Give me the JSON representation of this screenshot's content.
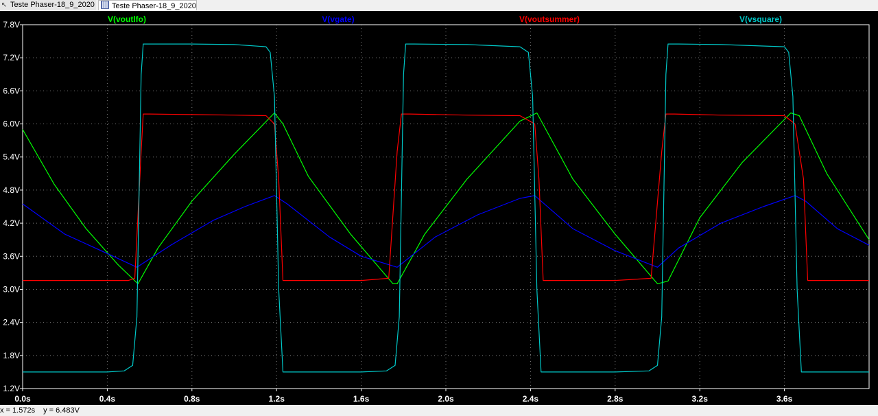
{
  "tabs": [
    {
      "label": "Teste Phaser-18_9_2020",
      "icon": "probe-icon"
    },
    {
      "label": "Teste Phaser-18_9_2020",
      "icon": "waveform-icon"
    }
  ],
  "status": {
    "x": "x = 1.572s",
    "y": "y = 6.483V"
  },
  "chart_data": {
    "type": "line",
    "title": "",
    "xlabel": "",
    "ylabel": "",
    "xlim": [
      0,
      4.0
    ],
    "ylim": [
      1.2,
      7.8
    ],
    "x_ticks": [
      0.0,
      0.4,
      0.8,
      1.2,
      1.6,
      2.0,
      2.4,
      2.8,
      3.2,
      3.6
    ],
    "x_tick_labels": [
      "0.0s",
      "0.4s",
      "0.8s",
      "1.2s",
      "1.6s",
      "2.0s",
      "2.4s",
      "2.8s",
      "3.2s",
      "3.6s"
    ],
    "y_ticks": [
      1.2,
      1.8,
      2.4,
      3.0,
      3.6,
      4.2,
      4.8,
      5.4,
      6.0,
      6.6,
      7.2,
      7.8
    ],
    "y_tick_labels": [
      "1.2V",
      "1.8V",
      "2.4V",
      "3.0V",
      "3.6V",
      "4.2V",
      "4.8V",
      "5.4V",
      "6.0V",
      "6.6V",
      "7.2V",
      "7.8V"
    ],
    "grid": true,
    "legend_position": "top",
    "background": "#000000",
    "series": [
      {
        "name": "V(voutlfo)",
        "color": "#00ff00",
        "x": [
          0.0,
          0.15,
          0.3,
          0.45,
          0.545,
          0.64,
          0.8,
          1.0,
          1.19,
          1.23,
          1.35,
          1.55,
          1.75,
          1.77,
          1.9,
          2.1,
          2.35,
          2.43,
          2.6,
          2.8,
          3.0,
          3.05,
          3.2,
          3.4,
          3.63,
          3.67,
          3.8,
          4.0
        ],
        "y": [
          5.9,
          4.9,
          4.1,
          3.45,
          3.1,
          3.75,
          4.6,
          5.45,
          6.2,
          6.0,
          5.05,
          4.0,
          3.1,
          3.1,
          4.0,
          5.0,
          6.05,
          6.2,
          5.0,
          4.0,
          3.1,
          3.15,
          4.3,
          5.3,
          6.2,
          6.15,
          5.1,
          3.9
        ]
      },
      {
        "name": "V(vgate)",
        "color": "#0000ff",
        "x": [
          0.0,
          0.2,
          0.4,
          0.54,
          0.7,
          0.9,
          1.05,
          1.19,
          1.25,
          1.45,
          1.6,
          1.77,
          1.95,
          2.15,
          2.35,
          2.42,
          2.6,
          2.8,
          3.0,
          3.1,
          3.3,
          3.5,
          3.65,
          3.7,
          3.85,
          4.0
        ],
        "y": [
          4.55,
          4.0,
          3.65,
          3.4,
          3.8,
          4.25,
          4.5,
          4.7,
          4.55,
          3.95,
          3.6,
          3.4,
          3.95,
          4.35,
          4.65,
          4.7,
          4.1,
          3.7,
          3.4,
          3.75,
          4.2,
          4.5,
          4.7,
          4.6,
          4.1,
          3.8
        ]
      },
      {
        "name": "V(voutsummer)",
        "color": "#ff0000",
        "x": [
          0.0,
          0.5,
          0.53,
          0.56,
          0.57,
          0.6,
          0.8,
          1.0,
          1.15,
          1.19,
          1.21,
          1.23,
          1.3,
          1.6,
          1.73,
          1.77,
          1.79,
          1.83,
          2.1,
          2.35,
          2.42,
          2.44,
          2.46,
          2.5,
          2.8,
          2.97,
          3.02,
          3.04,
          3.08,
          3.3,
          3.6,
          3.65,
          3.69,
          3.71,
          3.75,
          4.0
        ],
        "y": [
          3.16,
          3.16,
          3.2,
          5.5,
          6.18,
          6.18,
          6.17,
          6.16,
          6.15,
          6.0,
          5.0,
          3.16,
          3.16,
          3.16,
          3.2,
          5.5,
          6.18,
          6.18,
          6.16,
          6.15,
          6.0,
          5.0,
          3.16,
          3.16,
          3.16,
          3.2,
          5.5,
          6.18,
          6.18,
          6.16,
          6.15,
          6.0,
          5.0,
          3.16,
          3.16,
          3.16
        ]
      },
      {
        "name": "V(vsquare)",
        "color": "#00c8c8",
        "x": [
          0.0,
          0.4,
          0.48,
          0.52,
          0.54,
          0.56,
          0.57,
          0.6,
          0.8,
          1.0,
          1.15,
          1.17,
          1.19,
          1.21,
          1.23,
          1.3,
          1.6,
          1.72,
          1.76,
          1.78,
          1.8,
          1.81,
          1.85,
          2.1,
          2.35,
          2.39,
          2.41,
          2.43,
          2.45,
          2.47,
          2.55,
          2.8,
          2.96,
          3.0,
          3.02,
          3.04,
          3.05,
          3.1,
          3.3,
          3.6,
          3.62,
          3.64,
          3.66,
          3.68,
          3.7,
          3.8,
          4.0
        ],
        "y": [
          1.5,
          1.5,
          1.52,
          1.62,
          2.5,
          6.9,
          7.45,
          7.45,
          7.45,
          7.44,
          7.4,
          7.3,
          6.5,
          3.0,
          1.5,
          1.5,
          1.5,
          1.52,
          1.62,
          2.5,
          6.9,
          7.45,
          7.45,
          7.44,
          7.4,
          7.3,
          6.5,
          3.0,
          1.5,
          1.5,
          1.5,
          1.5,
          1.52,
          1.62,
          2.5,
          6.9,
          7.45,
          7.45,
          7.44,
          7.4,
          7.3,
          6.5,
          3.0,
          1.5,
          1.5,
          1.5,
          1.5
        ]
      }
    ]
  }
}
